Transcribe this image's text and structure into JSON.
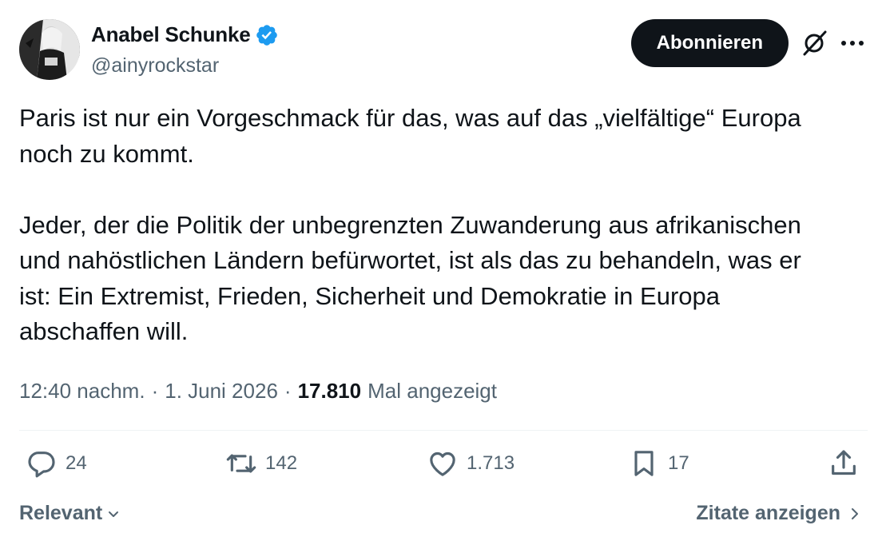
{
  "author": {
    "display_name": "Anabel Schunke",
    "handle": "@ainyrockstar",
    "verified": true,
    "verified_color": "#1d9bf0"
  },
  "header": {
    "follow_label": "Abonnieren",
    "grok_icon": "grok-icon",
    "more_icon": "more-icon"
  },
  "tweet": {
    "text": "Paris ist nur ein Vorgeschmack für das, was auf das „vielfältige“ Europa\nnoch zu kommt.\n\nJeder, der die Politik der unbegrenzten Zuwanderung aus afrikanischen\nund nahöstlichen Ländern befürwortet, ist als das zu behandeln, was er\nist: Ein Extremist, Frieden, Sicherheit und Demokratie in Europa\nabschaffen will."
  },
  "meta": {
    "time": "12:40 nachm.",
    "date": "1. Juni 2026",
    "views_count": "17.810",
    "views_label": "Mal angezeigt",
    "separator": "·"
  },
  "actions": {
    "replies": "24",
    "reposts": "142",
    "likes": "1.713",
    "bookmarks": "17"
  },
  "footer": {
    "sort_label": "Relevant",
    "quotes_label": "Zitate anzeigen"
  },
  "colors": {
    "text_primary": "#0f1419",
    "text_secondary": "#536471",
    "divider": "#eff3f4",
    "button_bg": "#0f1419"
  }
}
